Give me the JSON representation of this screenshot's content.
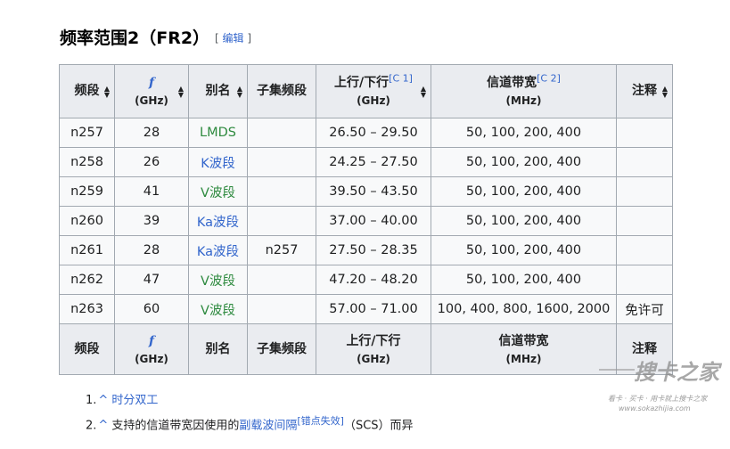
{
  "section": {
    "title": "频率范围2（FR2）",
    "edit_label": "编辑"
  },
  "table": {
    "headers": {
      "band": "频段",
      "freq_symbol": "f",
      "freq_unit": "(GHz)",
      "alias": "别名",
      "subset": "子集频段",
      "updown": "上行/下行",
      "updown_ref": "[C 1]",
      "updown_unit": "(GHz)",
      "bandwidth": "信道带宽",
      "bandwidth_ref": "[C 2]",
      "bandwidth_unit": "(MHz)",
      "notes": "注释"
    },
    "rows": [
      {
        "band": "n257",
        "freq": "28",
        "alias": "LMDS",
        "subset": "",
        "range": "26.50 – 29.50",
        "bw": "50, 100, 200, 400",
        "note": ""
      },
      {
        "band": "n258",
        "freq": "26",
        "alias": "K波段",
        "subset": "",
        "range": "24.25 – 27.50",
        "bw": "50, 100, 200, 400",
        "note": ""
      },
      {
        "band": "n259",
        "freq": "41",
        "alias": "V波段",
        "subset": "",
        "range": "39.50 – 43.50",
        "bw": "50, 100, 200, 400",
        "note": ""
      },
      {
        "band": "n260",
        "freq": "39",
        "alias": "Ka波段",
        "subset": "",
        "range": "37.00 – 40.00",
        "bw": "50, 100, 200, 400",
        "note": ""
      },
      {
        "band": "n261",
        "freq": "28",
        "alias": "Ka波段",
        "subset": "n257",
        "range": "27.50 – 28.35",
        "bw": "50, 100, 200, 400",
        "note": ""
      },
      {
        "band": "n262",
        "freq": "47",
        "alias": "V波段",
        "subset": "",
        "range": "47.20 – 48.20",
        "bw": "50, 100, 200, 400",
        "note": ""
      },
      {
        "band": "n263",
        "freq": "60",
        "alias": "V波段",
        "subset": "",
        "range": "57.00 – 71.00",
        "bw": "100, 400, 800, 1600, 2000",
        "note": "免许可"
      }
    ]
  },
  "notes": [
    {
      "num": "1.",
      "caret": "^",
      "text": "时分双工"
    },
    {
      "num": "2.",
      "caret": "^",
      "pre": "支持的信道带宽因使用的",
      "link": "副载波间隔",
      "sup": "[错点失效]",
      "post": "（SCS）而异"
    }
  ],
  "watermark": {
    "logo": "搜卡之家",
    "tagline": "看卡 · 买卡 · 用卡就上搜卡之家",
    "url": "www.sokazhijia.com"
  }
}
